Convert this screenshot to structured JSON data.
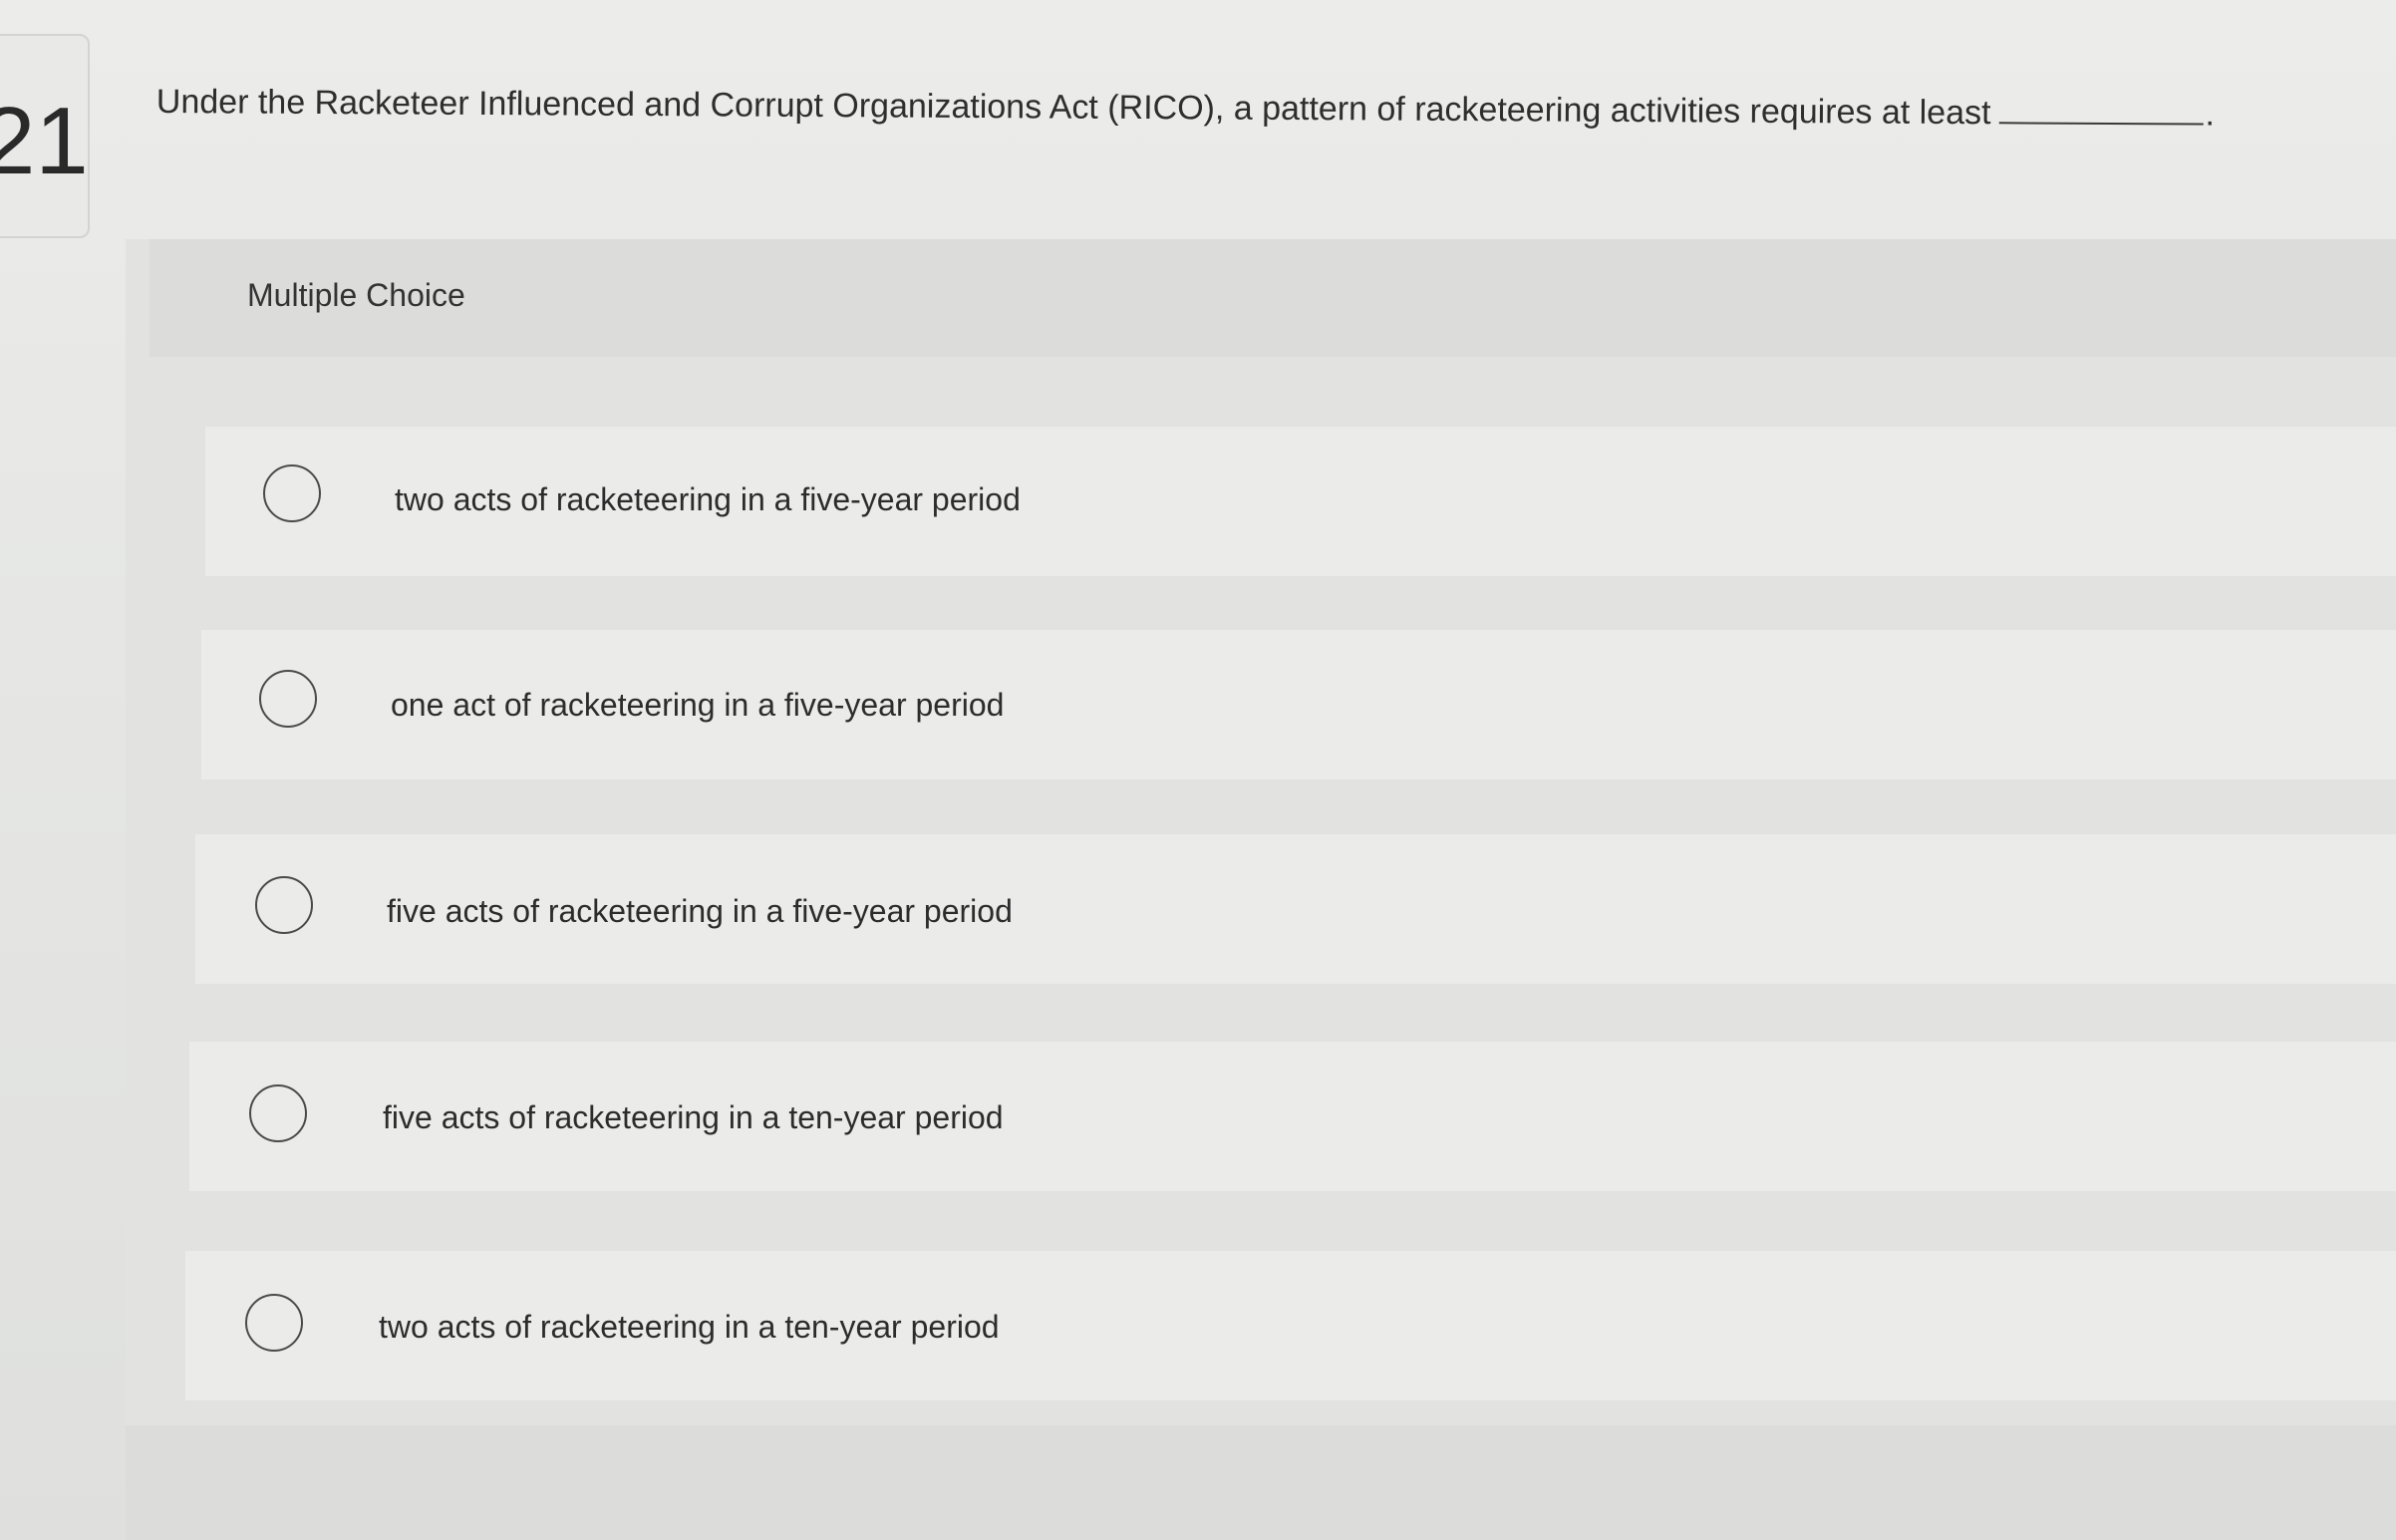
{
  "question": {
    "number": "21",
    "text": "Under the Racketeer Influenced and Corrupt Organizations Act (RICO), a pattern of racketeering activities requires at least",
    "end_punct": "."
  },
  "multiple_choice": {
    "label": "Multiple Choice",
    "options": [
      {
        "label": "two acts of racketeering in a five-year period",
        "selected": false
      },
      {
        "label": "one act of racketeering in a five-year period",
        "selected": false
      },
      {
        "label": "five acts of racketeering in a five-year period",
        "selected": false
      },
      {
        "label": "five acts of racketeering in a ten-year period",
        "selected": false
      },
      {
        "label": "two acts of racketeering in a ten-year period",
        "selected": false
      }
    ]
  }
}
